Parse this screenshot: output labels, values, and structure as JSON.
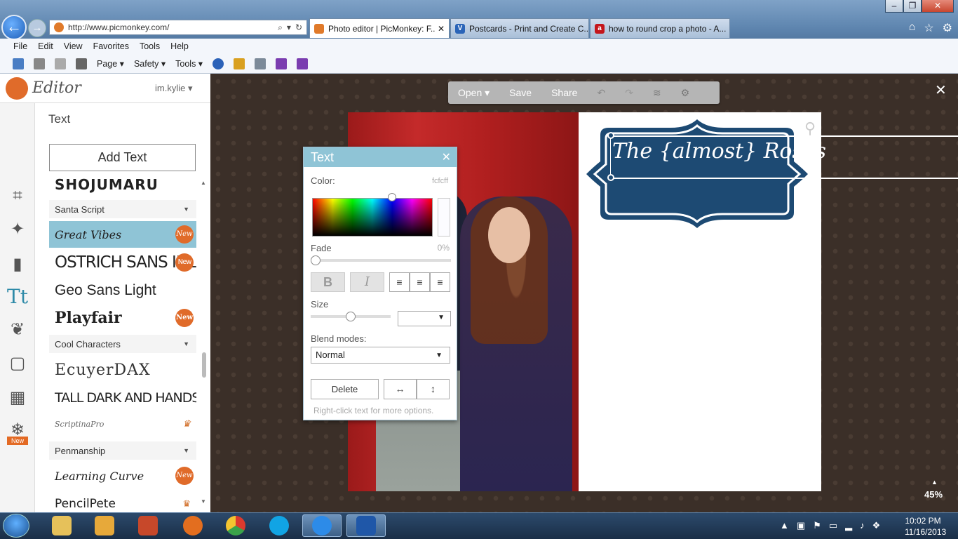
{
  "browser": {
    "address_url": "http://www.picmonkey.com/",
    "tabs": [
      {
        "label": "Photo editor | PicMonkey: F...",
        "icon": "picmonkey-tab-icon",
        "active": true
      },
      {
        "label": "Postcards - Print and Create C...",
        "icon": "vistaprint-tab-icon",
        "active": false
      },
      {
        "label": "how to round crop a photo - A...",
        "icon": "ask-tab-icon",
        "active": false
      }
    ],
    "menu": [
      "File",
      "Edit",
      "View",
      "Favorites",
      "Tools",
      "Help"
    ],
    "commands": {
      "page": "Page ▾",
      "safety": "Safety ▾",
      "tools": "Tools ▾"
    }
  },
  "editor": {
    "brand": "Editor",
    "user": "im.kylie ▾",
    "panel_title": "Text",
    "add_text_label": "Add Text",
    "fonts": [
      {
        "label": "SHOJUMARU",
        "kind": "font"
      },
      {
        "label": "Santa Script",
        "kind": "category"
      },
      {
        "label": "Great Vibes",
        "kind": "font",
        "badge": "New",
        "selected": true
      },
      {
        "label": "OSTRICH SANS INLINE",
        "kind": "font",
        "badge": "New"
      },
      {
        "label": "Geo Sans Light",
        "kind": "font"
      },
      {
        "label": "Playfair",
        "kind": "font",
        "badge": "New"
      },
      {
        "label": "Cool Characters",
        "kind": "category"
      },
      {
        "label": "EcuyerDAX",
        "kind": "font"
      },
      {
        "label": "TALL DARK AND HANDSOME",
        "kind": "font"
      },
      {
        "label": "ScriptinaPro",
        "kind": "font",
        "premium": true
      },
      {
        "label": "Penmanship",
        "kind": "category"
      },
      {
        "label": "Learning Curve",
        "kind": "font",
        "badge": "New"
      },
      {
        "label": "PencilPete",
        "kind": "font",
        "premium": true
      }
    ],
    "tool_new_badge": "New",
    "toolbar": {
      "open": "Open ▾",
      "save": "Save",
      "share": "Share"
    },
    "canvas_text": "The {almost} Roses",
    "zoom": "45%",
    "banner_color": "#1d4a73"
  },
  "text_dialog": {
    "title": "Text",
    "color_label": "Color:",
    "color_hex": "fcfcff",
    "fade_label": "Fade",
    "fade_value": "0%",
    "bold": "B",
    "italic": "I",
    "size_label": "Size",
    "blend_label": "Blend modes:",
    "blend_value": "Normal",
    "delete_label": "Delete",
    "hint": "Right-click text for more options."
  },
  "taskbar": {
    "time": "10:02 PM",
    "date": "11/16/2013"
  }
}
